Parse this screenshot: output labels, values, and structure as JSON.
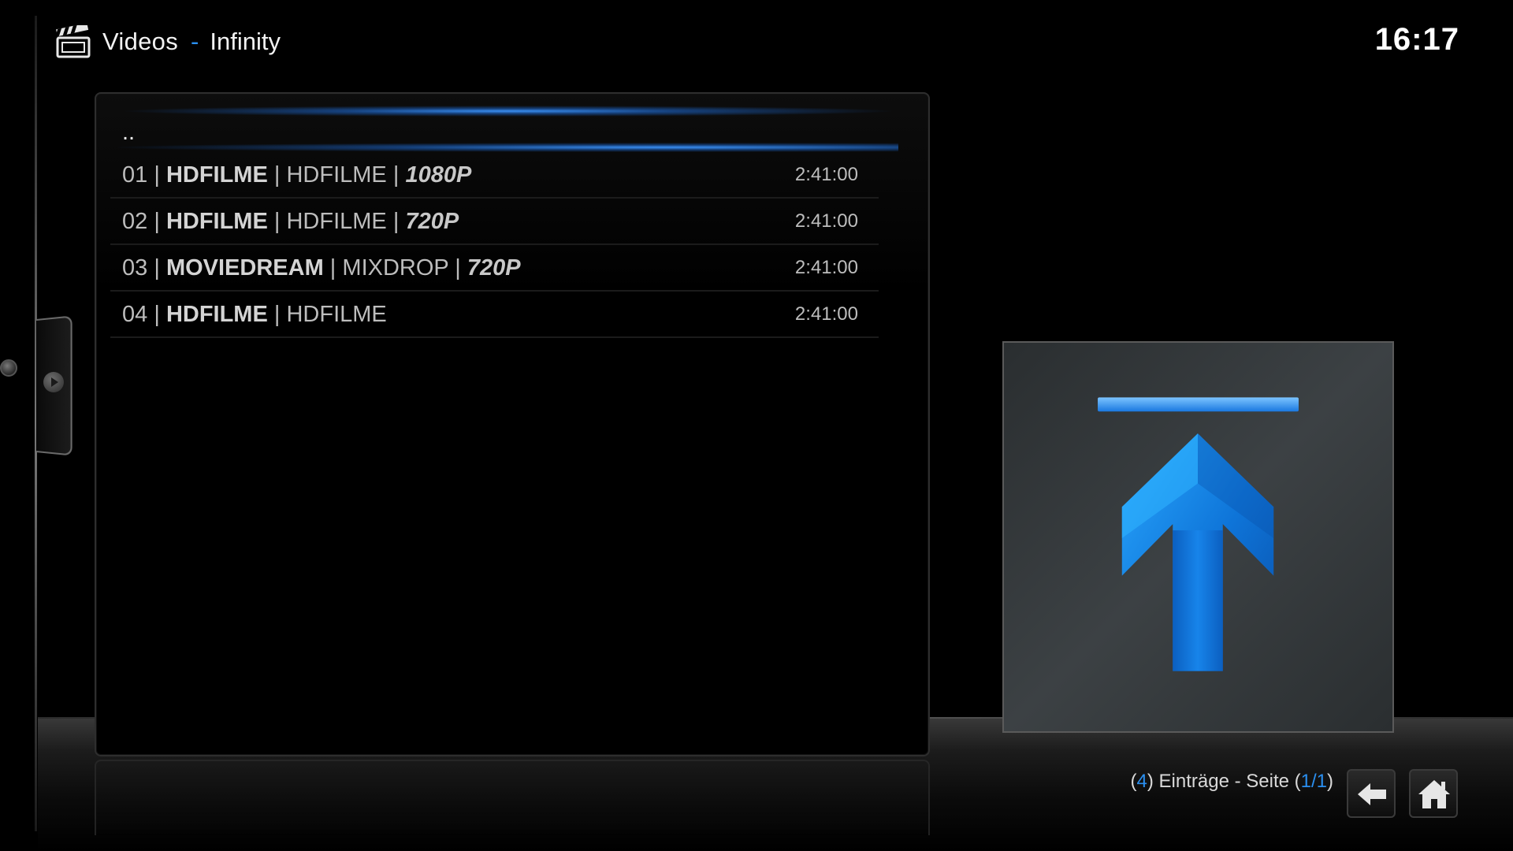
{
  "header": {
    "icon": "clapperboard-icon",
    "title": "Videos",
    "separator": "-",
    "subtitle": "Infinity"
  },
  "clock": "16:17",
  "list": {
    "parent_label": "..",
    "items": [
      {
        "num": "01",
        "sep": "|",
        "source": "HDFILME",
        "host": "HDFILME",
        "quality": "1080P",
        "duration": "2:41:00"
      },
      {
        "num": "02",
        "sep": "|",
        "source": "HDFILME",
        "host": "HDFILME",
        "quality": "720P",
        "duration": "2:41:00"
      },
      {
        "num": "03",
        "sep": "|",
        "source": "MOVIEDREAM",
        "host": "MIXDROP",
        "quality": "720P",
        "duration": "2:41:00"
      },
      {
        "num": "04",
        "sep": "|",
        "source": "HDFILME",
        "host": "HDFILME",
        "quality": "",
        "duration": "2:41:00"
      }
    ]
  },
  "footer": {
    "open_paren": "(",
    "count": "4",
    "entries_text": ") Einträge - Seite (",
    "page": "1/1",
    "close_paren": ")",
    "back_icon": "back-arrow-icon",
    "home_icon": "home-icon"
  },
  "artwork": {
    "icon": "folder-up-arrow-icon"
  },
  "colors": {
    "accent": "#2a8ff0",
    "background": "#000000",
    "text": "#bdbdbd"
  }
}
